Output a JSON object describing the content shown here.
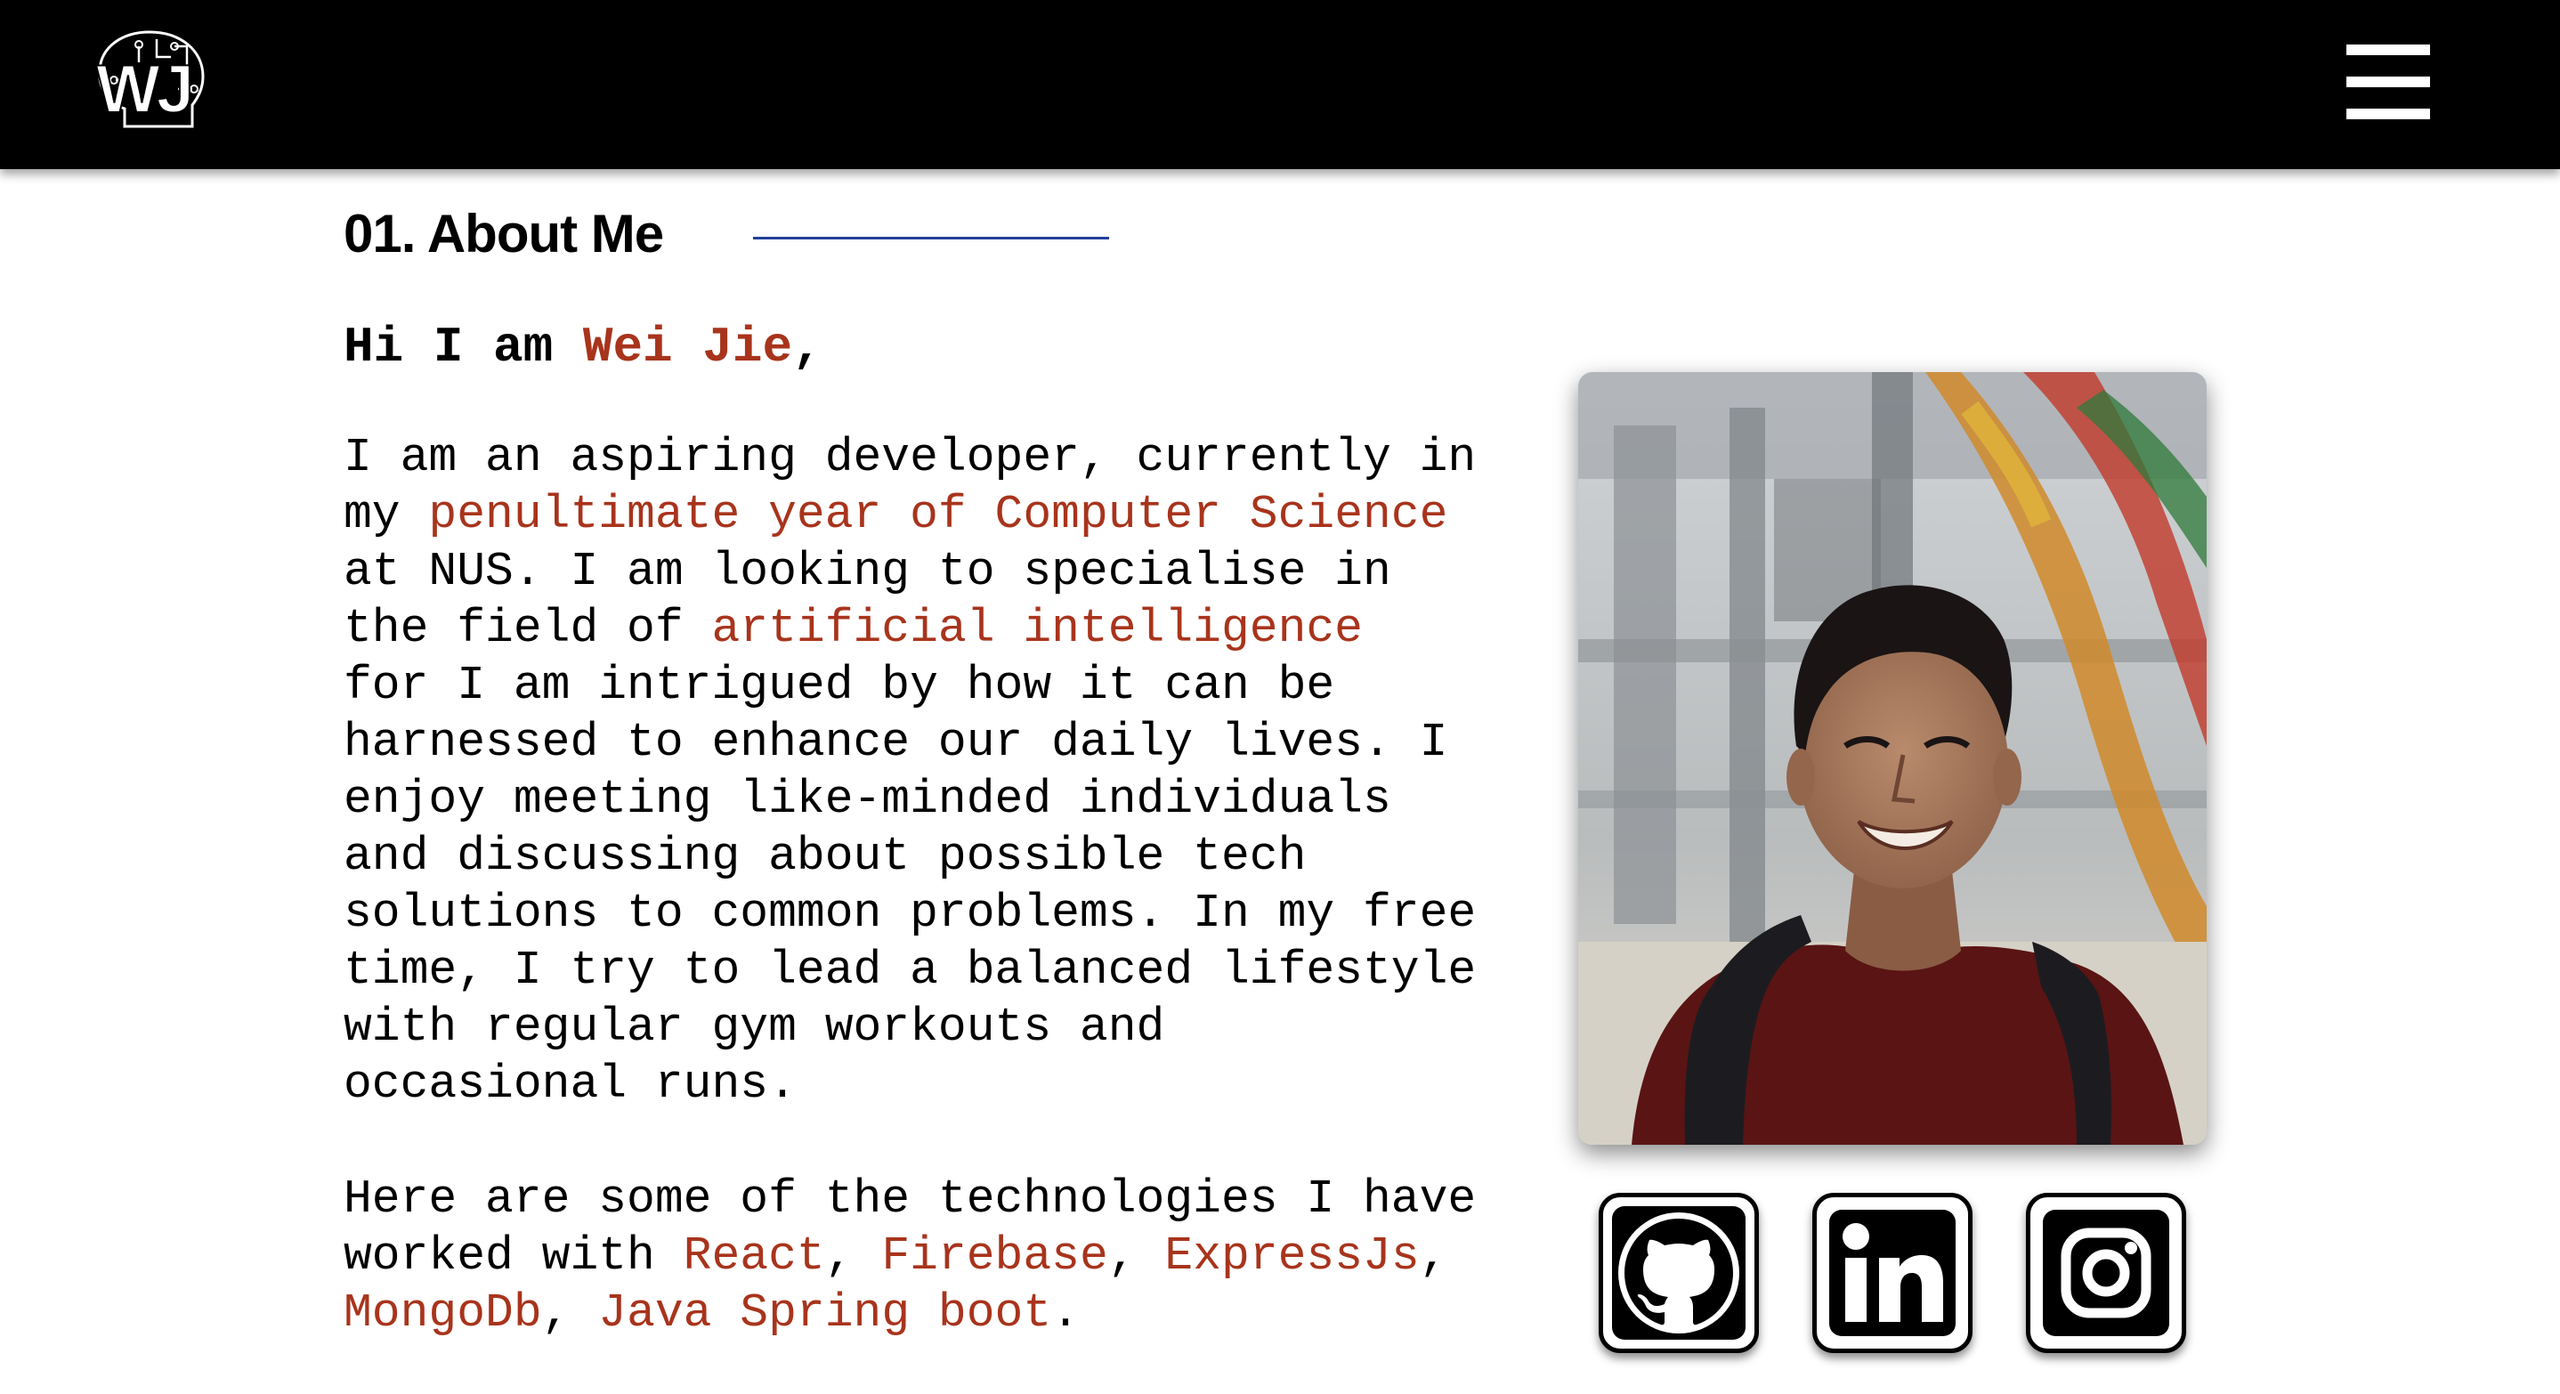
{
  "header": {
    "logo_text": "WJ",
    "logo_icon": "brain-circuit-logo",
    "menu_icon": "hamburger-menu-icon"
  },
  "section": {
    "title": "01. About Me"
  },
  "greeting": {
    "prefix": "Hi I am ",
    "name": "Wei Jie",
    "suffix": ","
  },
  "bio": {
    "l1": "I am an aspiring developer, currently in",
    "l2_pre": "my ",
    "l2_hl": "penultimate year of Computer Science",
    "l3": "at NUS. I am looking to specialise in",
    "l4_pre": "the field of ",
    "l4_hl": "artificial intelligence",
    "l5": "for I am intrigued by how it can be",
    "l6": "harnessed to enhance our daily lives. I",
    "l7": "enjoy meeting like-minded individuals",
    "l8": "and discussing about possible tech",
    "l9": "solutions to common problems. In my free",
    "l10": "time, I try to lead a balanced lifestyle",
    "l11": "with regular gym workouts and",
    "l12": "occasional runs."
  },
  "tech": {
    "l1": "Here are some of the technologies I have",
    "l2_pre": "worked with ",
    "items": [
      "React",
      "Firebase",
      "ExpressJs",
      "MongoDb",
      "Java Spring boot"
    ],
    "sep": ", ",
    "end": "."
  },
  "social": [
    {
      "name": "github",
      "icon": "github-icon"
    },
    {
      "name": "linkedin",
      "icon": "linkedin-icon"
    },
    {
      "name": "instagram",
      "icon": "instagram-icon"
    }
  ],
  "colors": {
    "accent": "#a8341c",
    "header_bg": "#000000",
    "rule": "#23409a"
  }
}
